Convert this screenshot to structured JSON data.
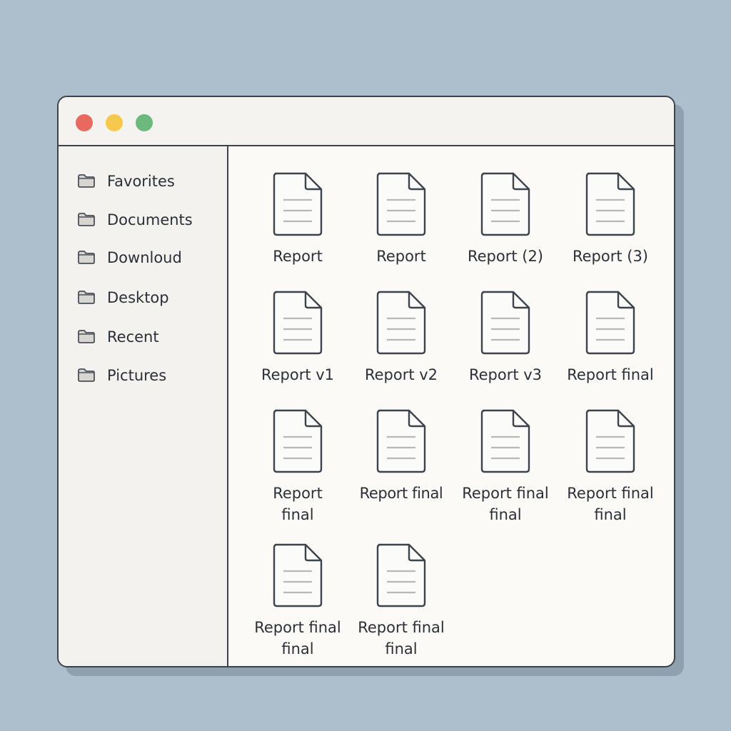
{
  "window": {
    "controls": [
      {
        "name": "close",
        "color": "#e8695f"
      },
      {
        "name": "minimize",
        "color": "#f7c84e"
      },
      {
        "name": "zoom",
        "color": "#6cb97d"
      }
    ]
  },
  "sidebar": {
    "items": [
      {
        "label": "Favorites",
        "icon": "folder-icon"
      },
      {
        "label": "Documents",
        "icon": "folder-icon"
      },
      {
        "label": "Downloud",
        "icon": "folder-icon"
      },
      {
        "label": "Desktop",
        "icon": "folder-icon"
      },
      {
        "label": "Recent",
        "icon": "folder-icon"
      },
      {
        "label": "Pictures",
        "icon": "folder-icon"
      }
    ]
  },
  "files": [
    {
      "label": "Report",
      "icon": "document-icon"
    },
    {
      "label": "Report",
      "icon": "document-icon"
    },
    {
      "label": "Report (2)",
      "icon": "document-icon"
    },
    {
      "label": "Report (3)",
      "icon": "document-icon"
    },
    {
      "label": "Report v1",
      "icon": "document-icon"
    },
    {
      "label": "Report v2",
      "icon": "document-icon"
    },
    {
      "label": "Report v3",
      "icon": "document-icon"
    },
    {
      "label": "Report final",
      "icon": "document-icon"
    },
    {
      "label": "Report final",
      "icon": "document-icon"
    },
    {
      "label": "Report final",
      "icon": "document-icon"
    },
    {
      "label": "Report final final",
      "icon": "document-icon"
    },
    {
      "label": "Report final final",
      "icon": "document-icon"
    },
    {
      "label": "Report final final",
      "icon": "document-icon"
    },
    {
      "label": "Report final final",
      "icon": "document-icon"
    }
  ],
  "colors": {
    "desktop": "#adbfcc",
    "window": "#fbfaf6",
    "sidebar": "#f4f2ee",
    "border": "#3d434c",
    "folder": "#d8d6d0",
    "document_line": "#b8b8b8"
  }
}
